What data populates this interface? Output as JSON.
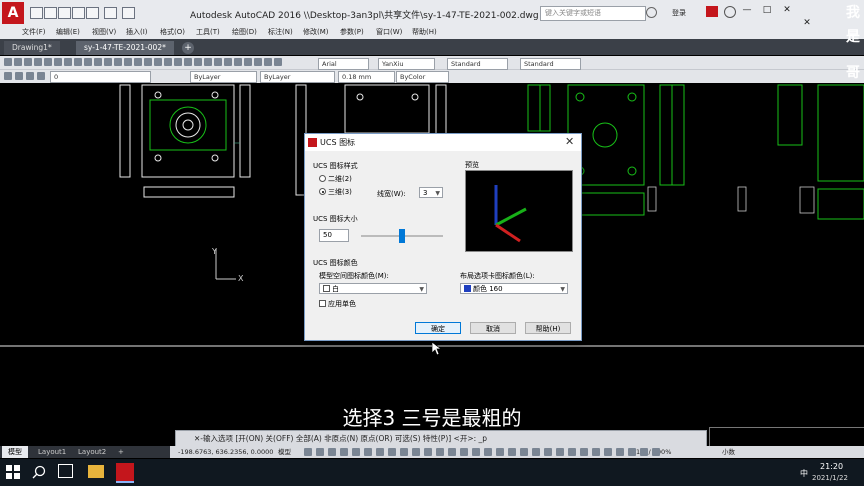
{
  "window": {
    "app_logo": "A",
    "title": "Autodesk AutoCAD 2016    \\\\Desktop-3an3pl\\共享文件\\sy-1-47-TE-2021-002.dwg",
    "search_placeholder": "键入关键字或短语",
    "signin": "登录",
    "min": "—",
    "max": "□",
    "close": "✕"
  },
  "menu": [
    "文件(F)",
    "编辑(E)",
    "视图(V)",
    "插入(I)",
    "格式(O)",
    "工具(T)",
    "绘图(D)",
    "标注(N)",
    "修改(M)",
    "参数(P)",
    "窗口(W)",
    "帮助(H)"
  ],
  "tabs": {
    "items": [
      {
        "label": "Drawing1*",
        "active": false
      },
      {
        "label": "sy-1-47-TE-2021-002*",
        "active": true
      }
    ],
    "add": "+"
  },
  "toolbar": {
    "font_combo": "Arial",
    "dim_combo": "YanXiu",
    "style_combo": "Standard",
    "style_combo2": "Standard",
    "layer_combo": "0",
    "color_combo": "ByLayer",
    "linetype_combo": "ByLayer",
    "lineweight_combo": "0.18 mm",
    "plotstyle_combo": "ByColor"
  },
  "ucs": {
    "y": "Y",
    "x": "X"
  },
  "dialog": {
    "title": "UCS 图标",
    "close": "✕",
    "style_group": "UCS 图标样式",
    "opt_2d": "二维(2)",
    "opt_3d": "三维(3)",
    "linewidth_label": "线宽(W):",
    "linewidth_value": "3",
    "preview_label": "预览",
    "size_group": "UCS 图标大小",
    "size_value": "50",
    "size_slider": 0.5,
    "color_group": "UCS 图标颜色",
    "model_color_label": "模型空间图标颜色(M):",
    "model_color_value": "白",
    "layout_color_label": "布局选项卡图标颜色(L):",
    "layout_color_value": "颜色 160",
    "apply_mono": "应用单色",
    "ok": "确定",
    "cancel": "取消",
    "help": "帮助(H)",
    "accent_blue": "#1f3fbf"
  },
  "subtitle": "选择3 三号是最粗的",
  "command": {
    "text": "✕-输入选项 [开(ON) 关(OFF) 全部(A) 非原点(N) 原点(OR) 可选(S) 特性(P)] <开>: _p"
  },
  "layout_tabs": [
    {
      "label": "模型",
      "active": true
    },
    {
      "label": "Layout1",
      "active": false
    },
    {
      "label": "Layout2",
      "active": false
    },
    {
      "label": "+",
      "active": false
    }
  ],
  "status": {
    "coords": "-198.6763, 636.2356, 0.0000",
    "model": "模型",
    "scale": "1:1 / 100%",
    "units": "小数"
  },
  "taskbar": {
    "time": "21:20",
    "date": "2021/1/22",
    "ime": "中"
  },
  "watermark": [
    "我",
    "是",
    "哥"
  ]
}
